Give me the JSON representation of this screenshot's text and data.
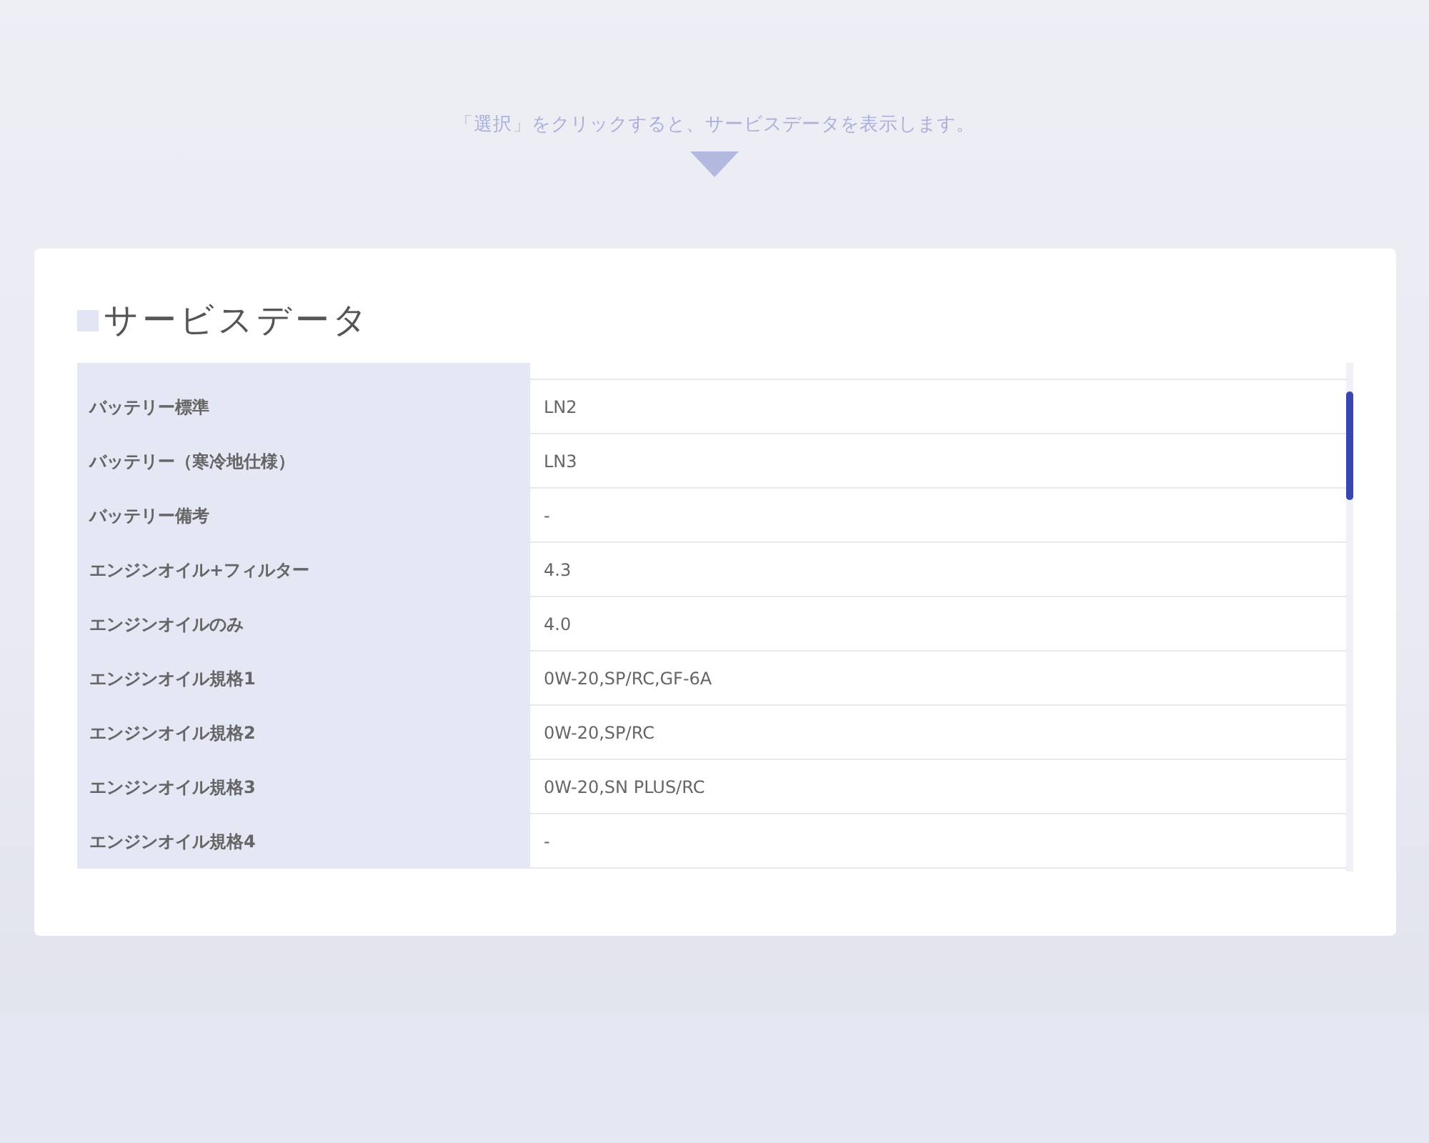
{
  "hint": {
    "text": "「選択」をクリックすると、サービスデータを表示します。"
  },
  "panel": {
    "title": "サービスデータ",
    "rows": [
      {
        "label": "バッテリー標準",
        "value": "LN2"
      },
      {
        "label": "バッテリー（寒冷地仕様）",
        "value": "LN3"
      },
      {
        "label": "バッテリー備考",
        "value": "-"
      },
      {
        "label": "エンジンオイル+フィルター",
        "value": "4.3"
      },
      {
        "label": "エンジンオイルのみ",
        "value": "4.0"
      },
      {
        "label": "エンジンオイル規格1",
        "value": "0W-20,SP/RC,GF-6A"
      },
      {
        "label": "エンジンオイル規格2",
        "value": "0W-20,SP/RC"
      },
      {
        "label": "エンジンオイル規格3",
        "value": "0W-20,SN PLUS/RC"
      },
      {
        "label": "エンジンオイル規格4",
        "value": "-"
      }
    ]
  }
}
